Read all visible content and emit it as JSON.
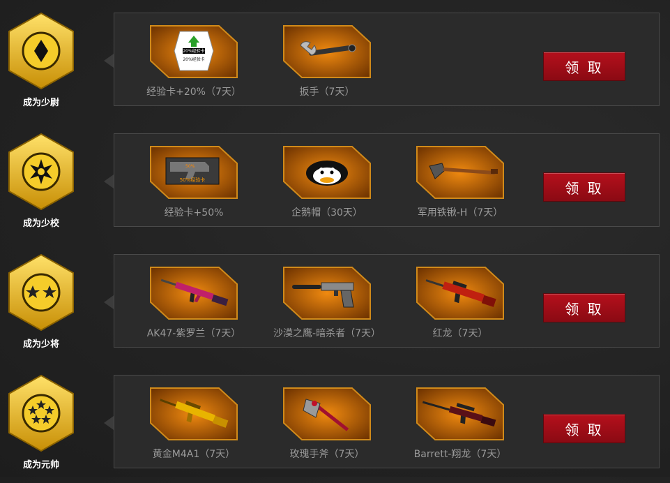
{
  "tiers": [
    {
      "rank": "成为少尉",
      "emblem": "diamond",
      "claim_label": "领 取",
      "items": [
        {
          "name": "经验卡+20%（7天）",
          "icon": "exp-card-20-icon",
          "card_text_1": "20%经验卡",
          "card_text_2": "20%经验卡"
        },
        {
          "name": "扳手（7天）",
          "icon": "wrench-icon"
        }
      ]
    },
    {
      "rank": "成为少校",
      "emblem": "burst",
      "claim_label": "领 取",
      "items": [
        {
          "name": "经验卡+50%",
          "icon": "exp-card-50-icon",
          "card_text_1": "50%",
          "card_text_2": "50%经验卡"
        },
        {
          "name": "企鹅帽（30天）",
          "icon": "penguin-hat-icon"
        },
        {
          "name": "军用铁锹-H（7天）",
          "icon": "shovel-icon"
        }
      ]
    },
    {
      "rank": "成为少将",
      "emblem": "two-stars",
      "claim_label": "领 取",
      "items": [
        {
          "name": "AK47-紫罗兰（7天）",
          "icon": "ak47-violet-icon"
        },
        {
          "name": "沙漠之鹰-暗杀者（7天）",
          "icon": "desert-eagle-icon"
        },
        {
          "name": "红龙（7天）",
          "icon": "red-dragon-rifle-icon"
        }
      ]
    },
    {
      "rank": "成为元帅",
      "emblem": "five-stars",
      "claim_label": "领 取",
      "items": [
        {
          "name": "黄金M4A1（7天）",
          "icon": "gold-m4a1-icon"
        },
        {
          "name": "玫瑰手斧（7天）",
          "icon": "rose-axe-icon"
        },
        {
          "name": "Barrett-翔龙（7天）",
          "icon": "barrett-sniper-icon"
        }
      ]
    }
  ],
  "colors": {
    "accent_orange": "#c86a06",
    "badge_gold": "#e8b816",
    "claim_red": "#a50e18"
  }
}
